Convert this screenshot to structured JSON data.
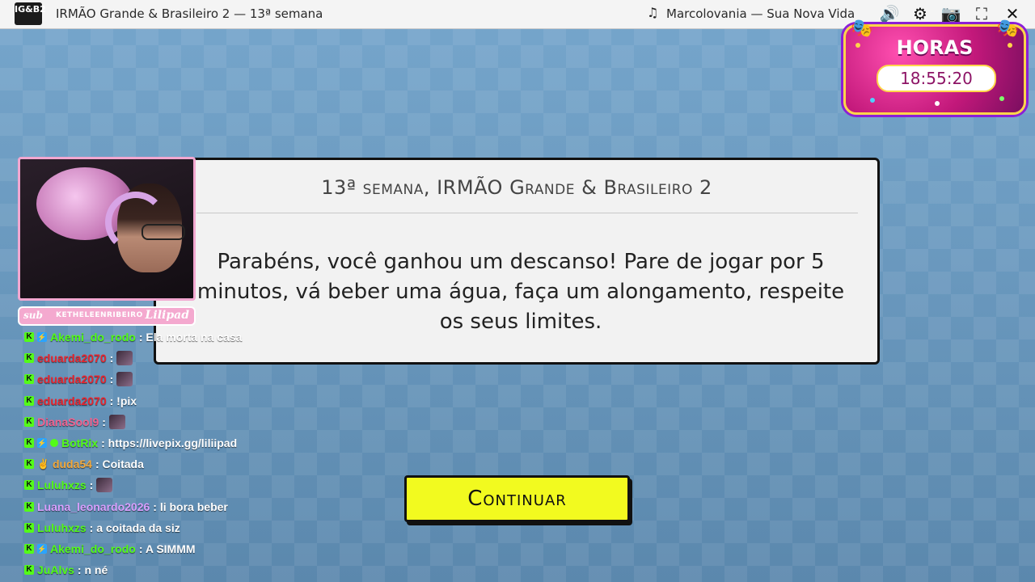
{
  "topbar": {
    "logo_text": "IG&B2",
    "window_title": "IRMÃO Grande & Brasileiro 2 — 13ª semana",
    "now_playing": "Marcolovania — Sua Nova Vida",
    "icons": [
      "music-note-icon",
      "volume-icon",
      "settings-icon",
      "camera-icon",
      "fullscreen-icon",
      "close-icon"
    ]
  },
  "hours": {
    "title": "HORAS",
    "time": "18:55:20"
  },
  "dialog": {
    "title": "13ª semana, IRMÃO Grande & Brasileiro 2",
    "message": "Parabéns, você ganhou um descanso! Pare de jogar por 5 minutos, vá beber uma água, faça um alongamento, respeite os seus limites."
  },
  "continue_label": "Continuar",
  "webcam": {
    "sub_label": "sub",
    "channel_name": "KETHELEENRIBEIRO",
    "tag": "Lilipad"
  },
  "chat": [
    {
      "user": "Akemi_do_rodo",
      "color": "#53fc18",
      "badges": [
        "kick",
        "ext"
      ],
      "message": ": Ela morta na casa",
      "emote": false
    },
    {
      "user": "eduarda2070",
      "color": "#e8252f",
      "badges": [
        "kick"
      ],
      "message": ":",
      "emote": true
    },
    {
      "user": "eduarda2070",
      "color": "#e8252f",
      "badges": [
        "kick"
      ],
      "message": ":",
      "emote": true
    },
    {
      "user": "eduarda2070",
      "color": "#e8252f",
      "badges": [
        "kick"
      ],
      "message": ": !pix",
      "emote": false
    },
    {
      "user": "DianaSool9",
      "color": "#f2628f",
      "badges": [
        "kick"
      ],
      "message": ":",
      "emote": true
    },
    {
      "user": "BotRix",
      "color": "#53fc18",
      "badges": [
        "kick",
        "ext",
        "verified"
      ],
      "message": ": https://livepix.gg/liliipad",
      "emote": false
    },
    {
      "user": "duda54",
      "color": "#f2a83b",
      "badges": [
        "kick",
        "hand"
      ],
      "message": ": Coitada",
      "emote": false
    },
    {
      "user": "Luluhxzs",
      "color": "#53fc18",
      "badges": [
        "kick"
      ],
      "message": ":",
      "emote": true
    },
    {
      "user": "Luana_leonardo2026",
      "color": "#d9a0ff",
      "badges": [
        "kick"
      ],
      "message": ": li bora beber",
      "emote": false
    },
    {
      "user": "Luluhxzs",
      "color": "#53fc18",
      "badges": [
        "kick"
      ],
      "message": ": a coitada da siz",
      "emote": false
    },
    {
      "user": "Akemi_do_rodo",
      "color": "#53fc18",
      "badges": [
        "kick",
        "ext"
      ],
      "message": ": A SIMMM",
      "emote": false
    },
    {
      "user": "JuAlvs",
      "color": "#53fc18",
      "badges": [
        "kick"
      ],
      "message": ": n né",
      "emote": false
    }
  ]
}
